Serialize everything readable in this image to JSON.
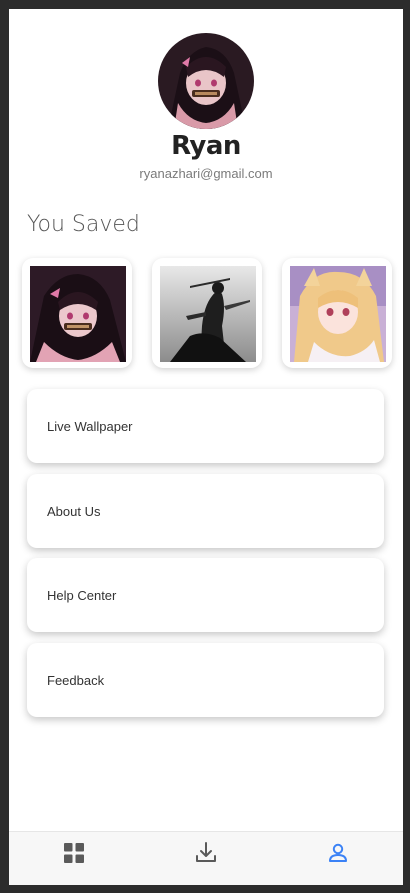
{
  "profile": {
    "name": "Ryan",
    "email": "ryanazhari@gmail.com"
  },
  "saved": {
    "title": "You Saved",
    "items": [
      {
        "image": "anime-girl-pink-kimono"
      },
      {
        "image": "samurai-monochrome"
      },
      {
        "image": "anime-girl-blonde"
      }
    ]
  },
  "menu": [
    {
      "label": "Live Wallpaper"
    },
    {
      "label": "About Us"
    },
    {
      "label": "Help Center"
    },
    {
      "label": "Feedback"
    }
  ],
  "bottom_nav": [
    {
      "icon": "grid-icon",
      "active": false
    },
    {
      "icon": "download-icon",
      "active": false
    },
    {
      "icon": "profile-icon",
      "active": true
    }
  ],
  "colors": {
    "active_nav": "#3b82f6",
    "inactive_nav": "#5a5a5a",
    "text_dark": "#222222",
    "text_muted": "#7a7a7a"
  }
}
